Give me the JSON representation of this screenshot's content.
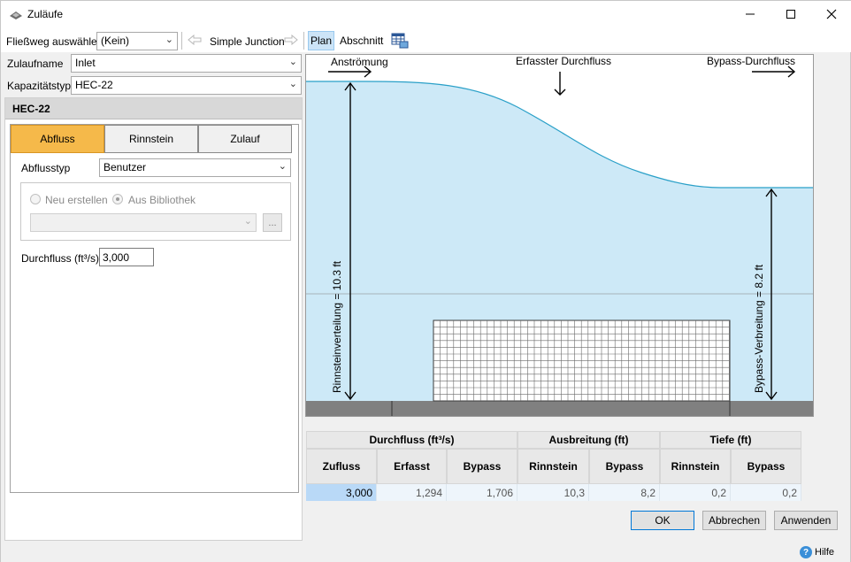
{
  "window": {
    "title": "Zuläufe",
    "minimize_icon": "minimize-icon",
    "maximize_icon": "maximize-icon",
    "close_icon": "close-icon"
  },
  "toolbar": {
    "flow_path_label": "Fließweg auswählen",
    "flow_path_value": "(Kein)",
    "back_icon": "arrow-left-icon",
    "junction_label": "Simple Junction",
    "forward_icon": "arrow-right-icon",
    "plan_tab": "Plan",
    "section_tab": "Abschnitt",
    "export_icon": "export-table-icon"
  },
  "form": {
    "inlet_name_label": "Zulaufname",
    "inlet_name_value": "Inlet",
    "capacity_type_label": "Kapazitätstyp",
    "capacity_type_value": "HEC-22",
    "group_header": "HEC-22",
    "tabs": [
      "Abfluss",
      "Rinnstein",
      "Zulauf"
    ],
    "flow_type_label": "Abflusstyp",
    "flow_type_value": "Benutzer",
    "radio_new": "Neu erstellen",
    "radio_library": "Aus Bibliothek",
    "library_value": "",
    "browse_label": "...",
    "discharge_label": "Durchfluss (ft³/s)",
    "discharge_value": "3,000"
  },
  "diagram": {
    "label_approach": "Anströmung",
    "label_captured": "Erfasster Durchfluss",
    "label_bypass": "Bypass-Durchfluss",
    "spread_left": "Rinnsteinverteilung = 10.3 ft",
    "spread_right": "Bypass-Verbreitung = 8.2 ft",
    "colors": {
      "water": "#cde9f7",
      "water_line": "#2aa0c8",
      "curb": "#808080",
      "grate": "#5a5a5a"
    }
  },
  "results": {
    "group_headers": [
      "Durchfluss (ft³/s)",
      "Ausbreitung (ft)",
      "Tiefe (ft)"
    ],
    "columns": [
      "Zufluss",
      "Erfasst",
      "Bypass",
      "Rinnstein",
      "Bypass",
      "Rinnstein",
      "Bypass"
    ],
    "values": [
      "3,000",
      "1,294",
      "1,706",
      "10,3",
      "8,2",
      "0,2",
      "0,2"
    ]
  },
  "buttons": {
    "ok": "OK",
    "cancel": "Abbrechen",
    "apply": "Anwenden",
    "help": "Hilfe",
    "help_icon": "help-icon"
  }
}
